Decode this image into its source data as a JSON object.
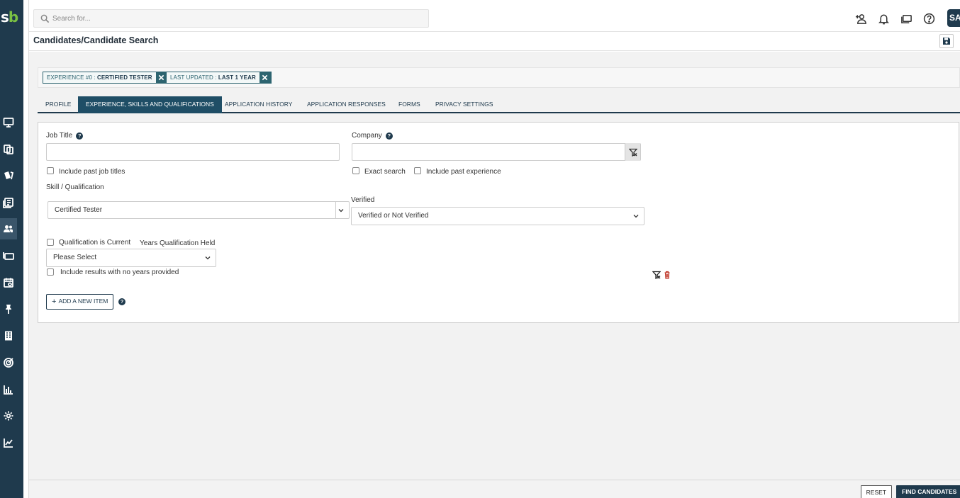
{
  "logo": {
    "text_a": "s",
    "text_b": "b"
  },
  "search": {
    "placeholder": "Search for..."
  },
  "header": {
    "avatar_initials": "SA"
  },
  "title": {
    "text": "Candidates/Candidate Search"
  },
  "chips": [
    {
      "label": "EXPERIENCE #0",
      "separator": " : ",
      "value": "CERTIFIED TESTER"
    },
    {
      "label": "LAST UPDATED",
      "separator": " : ",
      "value": "LAST 1 YEAR"
    }
  ],
  "tabs": [
    {
      "label": "PROFILE"
    },
    {
      "label": "EXPERIENCE, SKILLS AND QUALIFICATIONS"
    },
    {
      "label": "APPLICATION HISTORY"
    },
    {
      "label": "APPLICATION RESPONSES"
    },
    {
      "label": "FORMS"
    },
    {
      "label": "PRIVACY SETTINGS"
    }
  ],
  "form": {
    "job_title_label": "Job Title",
    "company_label": "Company",
    "include_past_titles": "Include past job titles",
    "exact_search": "Exact search",
    "include_past_experience": "Include past experience",
    "skill_label": "Skill / Qualification",
    "skill_value": "Certified Tester",
    "verified_label": "Verified",
    "verified_value": "Verified or Not Verified",
    "qualification_current": "Qualification is Current",
    "years_label": "Years Qualification Held",
    "years_value": "Please Select",
    "include_no_years": "Include results with no years provided",
    "add_item": "ADD A NEW ITEM",
    "help_glyph": "?"
  },
  "footer": {
    "reset": "RESET",
    "find": "FIND CANDIDATES"
  },
  "colors": {
    "brand": "#1f3a4d",
    "accent": "#7ac143",
    "delete": "#c0392b"
  }
}
